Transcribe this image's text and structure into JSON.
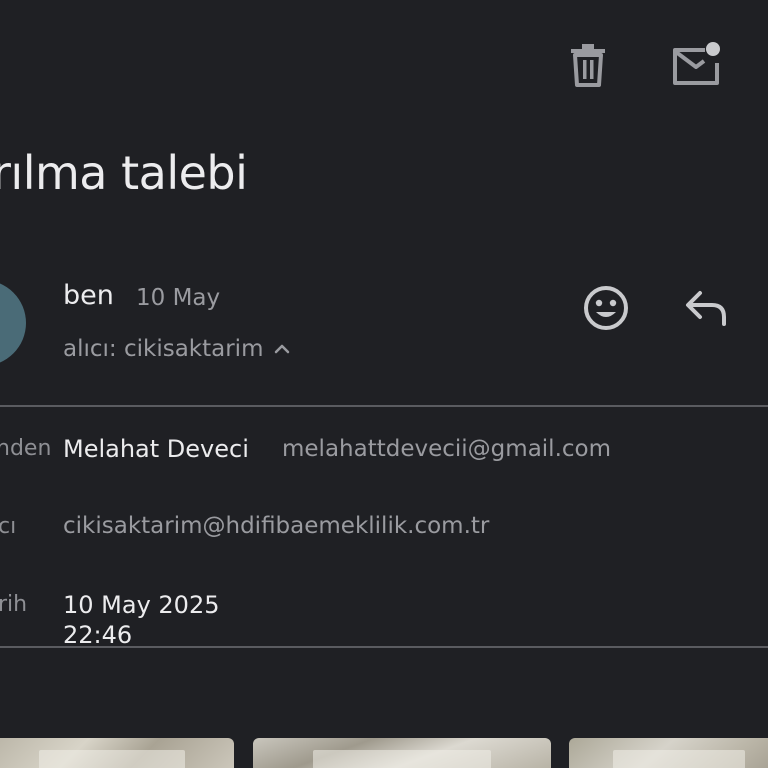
{
  "toolbar": {
    "delete_icon": "trash-icon",
    "mark_unread_icon": "mail-unread-icon"
  },
  "subject": "rılma talebi",
  "message": {
    "sender": "ben",
    "date": "10 May",
    "recipient_line": "alıcı: cikisaktarim",
    "react_icon": "emoji-icon",
    "reply_icon": "reply-icon"
  },
  "details": {
    "from_label": "nden",
    "from_name": "Melahat Deveci",
    "from_email": "melahattdevecii@gmail.com",
    "to_label": "cı",
    "to_email": "cikisaktarim@hdifibaemeklilik.com.tr",
    "date_label": "rih",
    "date_line1": "10 May 2025",
    "date_line2": "22:46"
  },
  "colors": {
    "background": "#1f2024",
    "avatar": "#4a6b77",
    "text_primary": "#ececee",
    "text_secondary": "#9a9ba0",
    "divider": "#5a5b60"
  }
}
